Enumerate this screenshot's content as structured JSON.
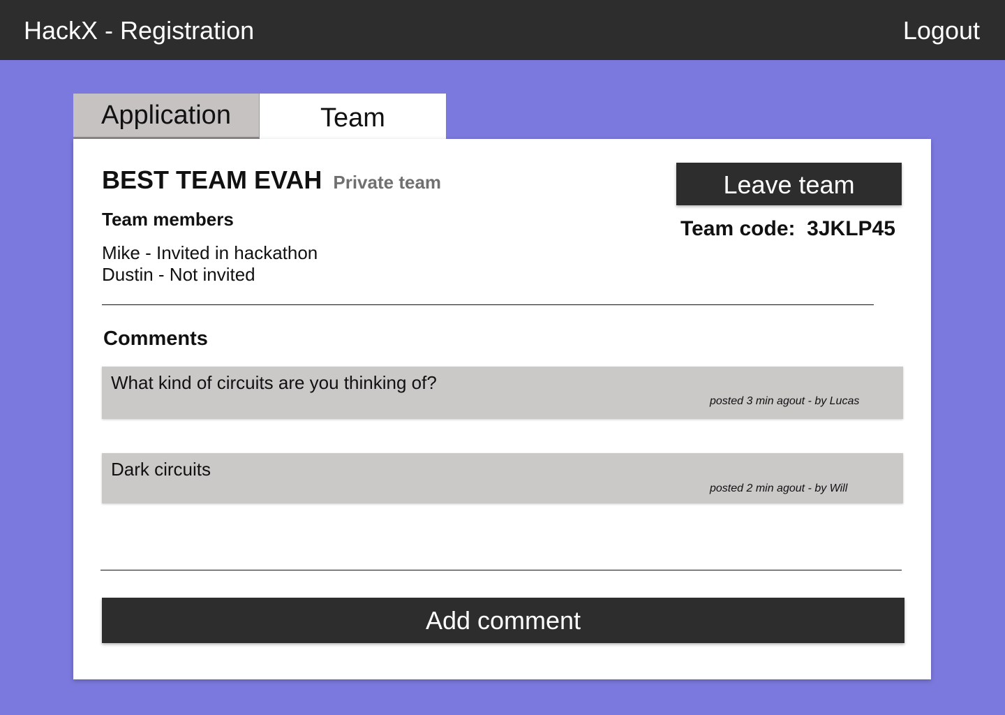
{
  "header": {
    "app_title": "HackX - Registration",
    "logout_label": "Logout"
  },
  "tabs": [
    {
      "label": "Application",
      "active": false
    },
    {
      "label": "Team",
      "active": true
    }
  ],
  "team": {
    "name": "BEST TEAM EVAH",
    "privacy": "Private team",
    "members_heading": "Team members",
    "members": [
      "Mike - Invited in hackathon",
      "Dustin -  Not invited"
    ],
    "leave_label": "Leave team",
    "code_text": "Team code:  3JKLP45"
  },
  "comments": {
    "heading": "Comments",
    "items": [
      {
        "text": "What kind of circuits are you thinking of?",
        "meta": "posted 3 min agout - by Lucas"
      },
      {
        "text": "Dark circuits",
        "meta": "posted 2 min agout - by Will"
      }
    ],
    "add_label": "Add comment"
  },
  "colors": {
    "background": "#7b79dd",
    "topbar": "#2d2d2d",
    "tab_inactive": "#c6c2c2",
    "comment_bg": "#cbc8c8",
    "button": "#2d2d2d"
  }
}
